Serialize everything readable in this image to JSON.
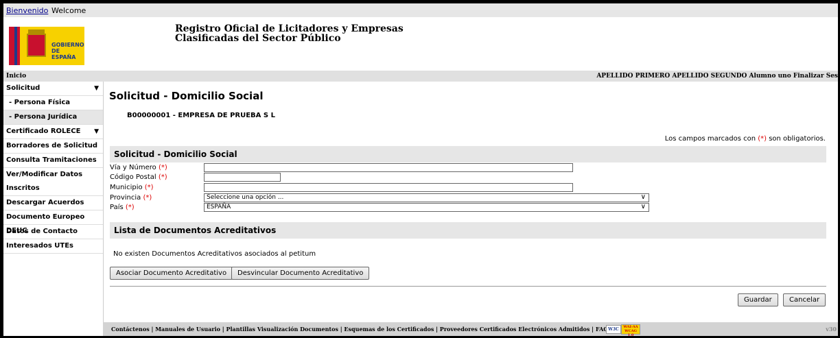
{
  "topbar": {
    "link": "Bienvenido",
    "welcome": "Welcome"
  },
  "header": {
    "logo_line1": "GOBIERNO",
    "logo_line2": "DE ESPAÑA",
    "title_line1": "Registro Oficial de Licitadores y Empresas",
    "title_line2": "Clasificadas del Sector Público"
  },
  "navbar": {
    "inicio": "Inicio",
    "user": "APELLIDO PRIMERO APELLIDO SEGUNDO Alumno uno",
    "logout": "Finalizar Ses"
  },
  "sidebar": {
    "items": [
      {
        "label": "Solicitud",
        "arrow": "▼"
      },
      {
        "label": "- Persona Física"
      },
      {
        "label": "- Persona Jurídica"
      },
      {
        "label": "Certificado ROLECE",
        "arrow": "▼"
      },
      {
        "label": "Borradores de Solicitud"
      },
      {
        "label": "Consulta Tramitaciones"
      },
      {
        "label": "Ver/Modificar Datos Inscritos"
      },
      {
        "label": "Descargar Acuerdos"
      },
      {
        "label": "Documento Europeo DEUC"
      },
      {
        "label": "Datos de Contacto"
      },
      {
        "label": "Interesados UTEs"
      }
    ]
  },
  "main": {
    "page_title": "Solicitud - Domicilio Social",
    "empresa": "B00000001 - EMPRESA DE PRUEBA S L",
    "oblig_pre": "Los campos marcados con ",
    "req_mark": "(*)",
    "oblig_post": " son obligatorios.",
    "section_title": "Solicitud - Domicilio Social",
    "fields": {
      "via": {
        "label": "Vía y Número ",
        "value": ""
      },
      "cp": {
        "label": "Código Postal ",
        "value": ""
      },
      "municipio": {
        "label": "Municipio ",
        "value": ""
      },
      "provincia": {
        "label": "Provincia ",
        "value": "Seleccione una opción ..."
      },
      "pais": {
        "label": "País ",
        "value": "ESPAÑA"
      }
    },
    "docs_title": "Lista de Documentos Acreditativos",
    "docs_msg": "No existen Documentos Acreditativos asociados al petitum",
    "btn_asociar": "Asociar Documento Acreditativo",
    "btn_desvincular": "Desvincular Documento Acreditativo",
    "btn_guardar": "Guardar",
    "btn_cancelar": "Cancelar"
  },
  "footer": {
    "links": "Contáctenos | Manuales de Usuario | Plantillas Visualización Documentos | Esquemas de los Certificados  |  Proveedores Certificados Electrónicos Admitidos | FAQ",
    "w3c": "W3C",
    "wai_line1": "WAI-AA",
    "wai_line2": "WCAG 1.0",
    "version": "v30"
  },
  "icons": {
    "dropdown": "chevron-down-icon",
    "logo": "coat-of-arms-icon"
  },
  "colors": {
    "required": "#dd0000",
    "section_bg": "#e6e6e6",
    "footer_bg": "#d3d3d3"
  }
}
